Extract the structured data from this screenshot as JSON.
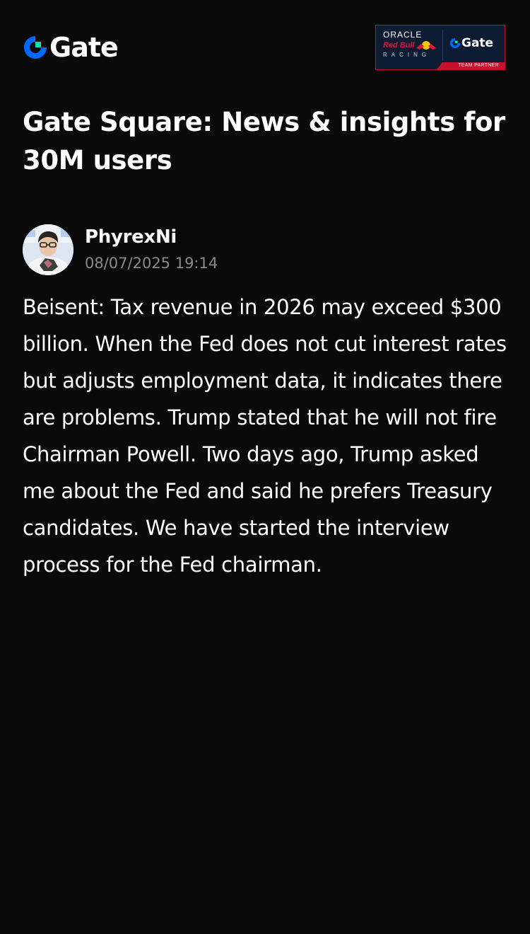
{
  "brand": {
    "name": "Gate",
    "accent_color": "#0068ff",
    "secondary_color": "#00e6a8"
  },
  "partner_badge": {
    "oracle": "ORACLE",
    "redbull": "Red Bull",
    "racing": "RACING",
    "gate": "Gate",
    "footer": "TEAM PARTNER"
  },
  "page": {
    "title": "Gate Square: News & insights for 30M users"
  },
  "post": {
    "author": "PhyrexNi",
    "timestamp": "08/07/2025 19:14",
    "body": "Beisent: Tax revenue in 2026 may exceed $300 billion. When the Fed does not cut interest rates but adjusts employment data, it indicates there are problems. Trump stated that he will not fire Chairman Powell. Two days ago, Trump asked me about the Fed and said he prefers Treasury candidates. We have started the interview process for the Fed chairman."
  }
}
